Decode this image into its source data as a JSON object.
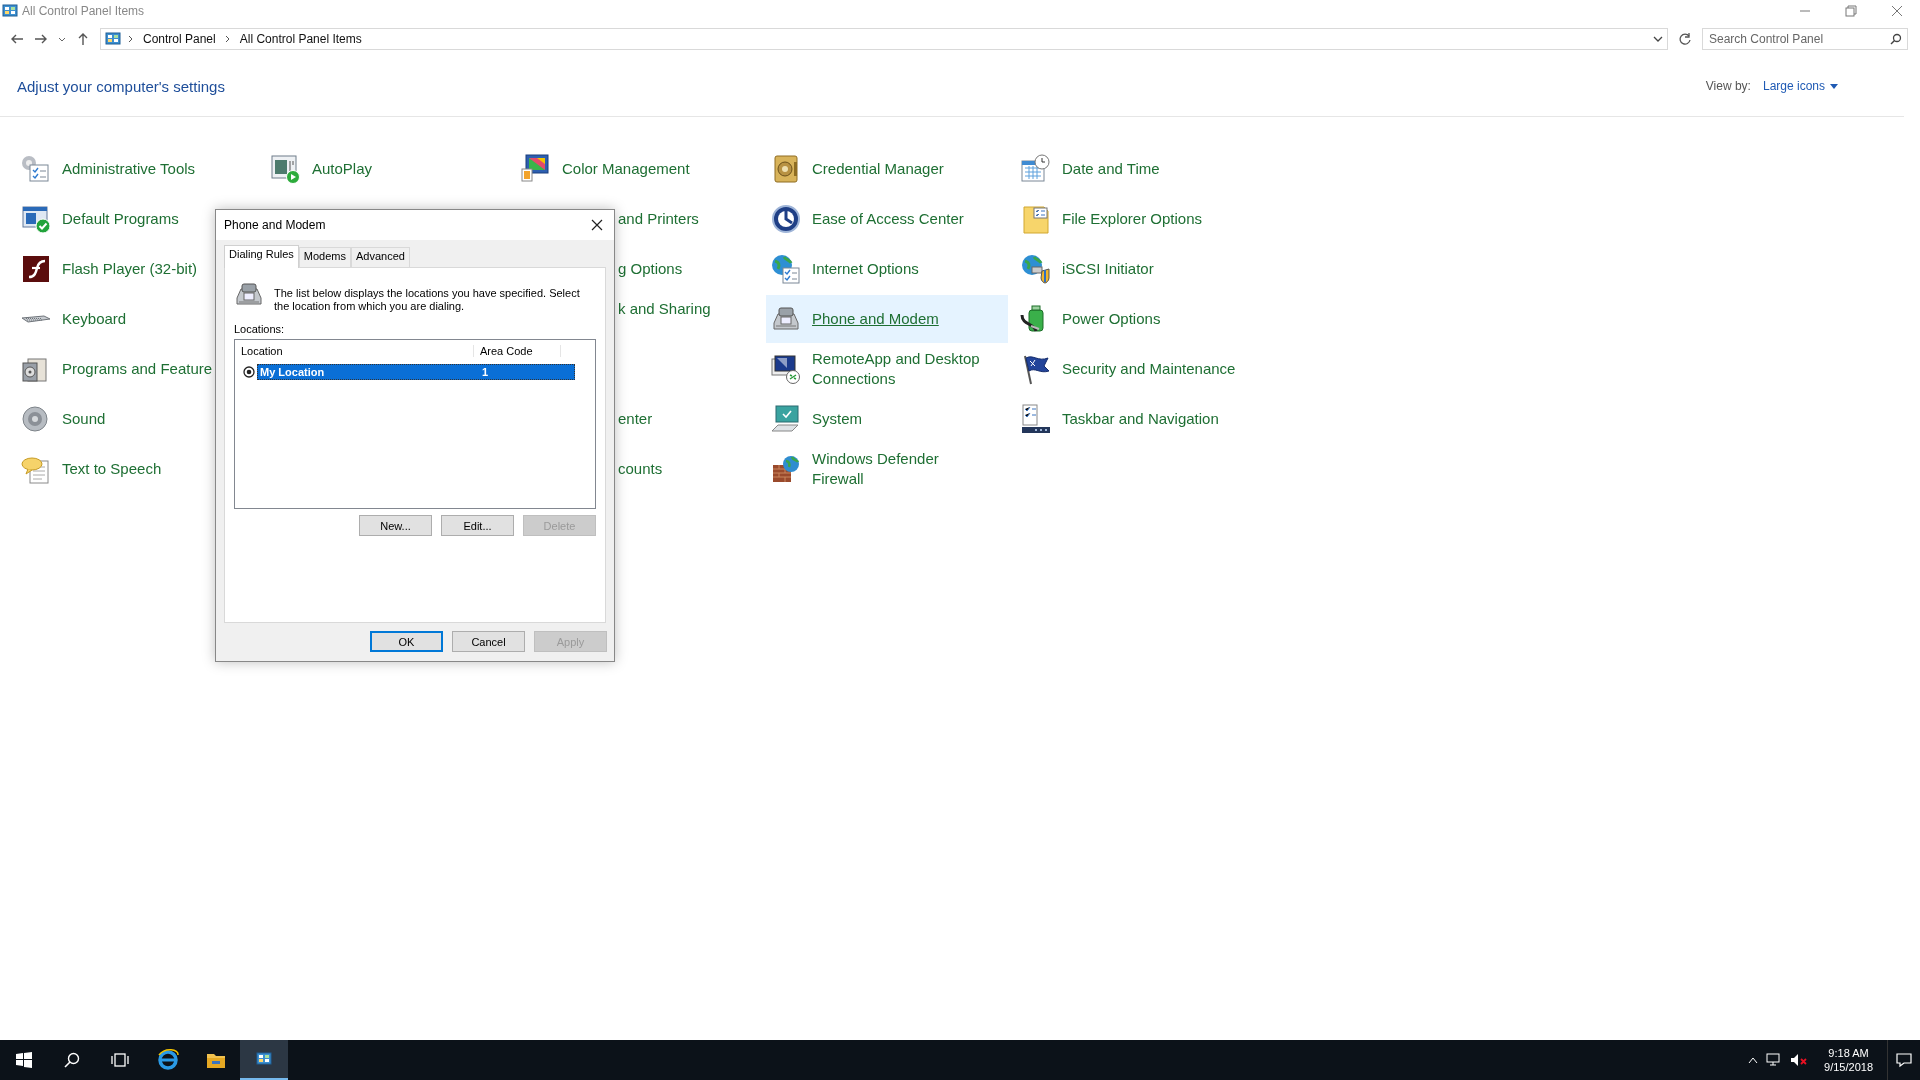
{
  "window": {
    "title": "All Control Panel Items"
  },
  "address_bar": {
    "breadcrumbs": [
      "Control Panel",
      "All Control Panel Items"
    ]
  },
  "search": {
    "placeholder": "Search Control Panel"
  },
  "heading": "Adjust your computer's settings",
  "view_by": {
    "label": "View by:",
    "value": "Large icons"
  },
  "columns": [
    {
      "items": [
        {
          "label": "Administrative Tools",
          "kind": "full",
          "selected": false
        },
        {
          "label": "Default Programs",
          "kind": "full",
          "selected": false
        },
        {
          "label": "Flash Player (32-bit)",
          "kind": "full",
          "selected": false
        },
        {
          "label": "Keyboard",
          "kind": "full",
          "selected": false
        },
        {
          "label": "Programs and Feature",
          "kind": "full",
          "selected": false
        },
        {
          "label": "Sound",
          "kind": "full",
          "selected": false
        },
        {
          "label": "Text to Speech",
          "kind": "full",
          "selected": false
        }
      ]
    },
    {
      "items": [
        {
          "label": "AutoPlay",
          "kind": "full",
          "selected": false
        }
      ]
    },
    {
      "items": [
        {
          "label": "Color Management",
          "kind": "full",
          "selected": false
        },
        {
          "label": "and Printers",
          "kind": "covered",
          "selected": false
        },
        {
          "label": "g Options",
          "kind": "covered",
          "selected": false
        },
        {
          "label": "k and Sharing",
          "kind": "covered",
          "selected": false
        },
        {
          "label": "enter",
          "kind": "covered",
          "selected": false
        },
        {
          "label": "counts",
          "kind": "covered",
          "selected": false
        }
      ]
    },
    {
      "items": [
        {
          "label": "Credential Manager",
          "kind": "full",
          "selected": false
        },
        {
          "label": "Ease of Access Center",
          "kind": "full",
          "selected": false
        },
        {
          "label": "Internet Options",
          "kind": "full",
          "selected": false
        },
        {
          "label": "Phone and Modem",
          "kind": "full",
          "selected": true
        },
        {
          "label": "RemoteApp and Desktop Connections",
          "kind": "full",
          "selected": false
        },
        {
          "label": "System",
          "kind": "full",
          "selected": false
        },
        {
          "label": "Windows Defender Firewall",
          "kind": "full",
          "selected": false
        }
      ]
    },
    {
      "items": [
        {
          "label": "Date and Time",
          "kind": "full",
          "selected": false
        },
        {
          "label": "File Explorer Options",
          "kind": "full",
          "selected": false
        },
        {
          "label": "iSCSI Initiator",
          "kind": "full",
          "selected": false
        },
        {
          "label": "Power Options",
          "kind": "full",
          "selected": false
        },
        {
          "label": "Security and Maintenance",
          "kind": "full",
          "selected": false
        },
        {
          "label": "Taskbar and Navigation",
          "kind": "full",
          "selected": false
        }
      ]
    }
  ],
  "dialog": {
    "title": "Phone and Modem",
    "tabs": [
      {
        "label": "Dialing Rules",
        "selected": true
      },
      {
        "label": "Modems",
        "selected": false
      },
      {
        "label": "Advanced",
        "selected": false
      }
    ],
    "description": "The list below displays the locations you have specified. Select the location from which you are dialing.",
    "locations_label": "Locations:",
    "list": {
      "columns": [
        "Location",
        "Area Code"
      ],
      "rows": [
        {
          "location": "My Location",
          "area_code": "1",
          "selected": true,
          "default": true
        }
      ]
    },
    "list_buttons": [
      {
        "label": "New...",
        "disabled": false
      },
      {
        "label": "Edit...",
        "disabled": false
      },
      {
        "label": "Delete",
        "disabled": true
      }
    ],
    "buttons": [
      {
        "label": "OK",
        "disabled": false,
        "default": true
      },
      {
        "label": "Cancel",
        "disabled": false,
        "default": false
      },
      {
        "label": "Apply",
        "disabled": true,
        "default": false
      }
    ]
  },
  "taskbar": {
    "apps": [
      {
        "selected": false
      },
      {
        "selected": false
      },
      {
        "selected": true
      }
    ],
    "clock": {
      "time": "9:18 AM",
      "date": "9/15/2018"
    }
  }
}
